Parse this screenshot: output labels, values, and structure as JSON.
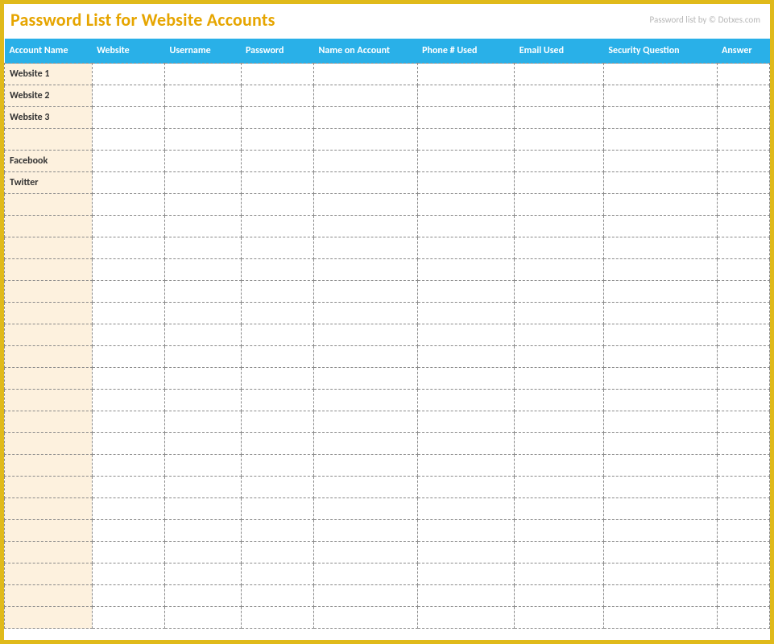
{
  "header": {
    "title": "Password List for Website Accounts",
    "credit": "Password list by © Dotxes.com"
  },
  "columns": {
    "account_name": "Account Name",
    "website": "Website",
    "username": "Username",
    "password": "Password",
    "name_on_account": "Name on Account",
    "phone_used": "Phone # Used",
    "email_used": "Email Used",
    "security_question": "Security Question",
    "answer": "Answer"
  },
  "rows": [
    {
      "account_name": "Website 1",
      "website": "",
      "username": "",
      "password": "",
      "name_on_account": "",
      "phone_used": "",
      "email_used": "",
      "security_question": "",
      "answer": ""
    },
    {
      "account_name": "Website 2",
      "website": "",
      "username": "",
      "password": "",
      "name_on_account": "",
      "phone_used": "",
      "email_used": "",
      "security_question": "",
      "answer": ""
    },
    {
      "account_name": "Website 3",
      "website": "",
      "username": "",
      "password": "",
      "name_on_account": "",
      "phone_used": "",
      "email_used": "",
      "security_question": "",
      "answer": ""
    },
    {
      "account_name": "",
      "website": "",
      "username": "",
      "password": "",
      "name_on_account": "",
      "phone_used": "",
      "email_used": "",
      "security_question": "",
      "answer": ""
    },
    {
      "account_name": "Facebook",
      "website": "",
      "username": "",
      "password": "",
      "name_on_account": "",
      "phone_used": "",
      "email_used": "",
      "security_question": "",
      "answer": ""
    },
    {
      "account_name": "Twitter",
      "website": "",
      "username": "",
      "password": "",
      "name_on_account": "",
      "phone_used": "",
      "email_used": "",
      "security_question": "",
      "answer": ""
    },
    {
      "account_name": "",
      "website": "",
      "username": "",
      "password": "",
      "name_on_account": "",
      "phone_used": "",
      "email_used": "",
      "security_question": "",
      "answer": ""
    },
    {
      "account_name": "",
      "website": "",
      "username": "",
      "password": "",
      "name_on_account": "",
      "phone_used": "",
      "email_used": "",
      "security_question": "",
      "answer": ""
    },
    {
      "account_name": "",
      "website": "",
      "username": "",
      "password": "",
      "name_on_account": "",
      "phone_used": "",
      "email_used": "",
      "security_question": "",
      "answer": ""
    },
    {
      "account_name": "",
      "website": "",
      "username": "",
      "password": "",
      "name_on_account": "",
      "phone_used": "",
      "email_used": "",
      "security_question": "",
      "answer": ""
    },
    {
      "account_name": "",
      "website": "",
      "username": "",
      "password": "",
      "name_on_account": "",
      "phone_used": "",
      "email_used": "",
      "security_question": "",
      "answer": ""
    },
    {
      "account_name": "",
      "website": "",
      "username": "",
      "password": "",
      "name_on_account": "",
      "phone_used": "",
      "email_used": "",
      "security_question": "",
      "answer": ""
    },
    {
      "account_name": "",
      "website": "",
      "username": "",
      "password": "",
      "name_on_account": "",
      "phone_used": "",
      "email_used": "",
      "security_question": "",
      "answer": ""
    },
    {
      "account_name": "",
      "website": "",
      "username": "",
      "password": "",
      "name_on_account": "",
      "phone_used": "",
      "email_used": "",
      "security_question": "",
      "answer": ""
    },
    {
      "account_name": "",
      "website": "",
      "username": "",
      "password": "",
      "name_on_account": "",
      "phone_used": "",
      "email_used": "",
      "security_question": "",
      "answer": ""
    },
    {
      "account_name": "",
      "website": "",
      "username": "",
      "password": "",
      "name_on_account": "",
      "phone_used": "",
      "email_used": "",
      "security_question": "",
      "answer": ""
    },
    {
      "account_name": "",
      "website": "",
      "username": "",
      "password": "",
      "name_on_account": "",
      "phone_used": "",
      "email_used": "",
      "security_question": "",
      "answer": ""
    },
    {
      "account_name": "",
      "website": "",
      "username": "",
      "password": "",
      "name_on_account": "",
      "phone_used": "",
      "email_used": "",
      "security_question": "",
      "answer": ""
    },
    {
      "account_name": "",
      "website": "",
      "username": "",
      "password": "",
      "name_on_account": "",
      "phone_used": "",
      "email_used": "",
      "security_question": "",
      "answer": ""
    },
    {
      "account_name": "",
      "website": "",
      "username": "",
      "password": "",
      "name_on_account": "",
      "phone_used": "",
      "email_used": "",
      "security_question": "",
      "answer": ""
    },
    {
      "account_name": "",
      "website": "",
      "username": "",
      "password": "",
      "name_on_account": "",
      "phone_used": "",
      "email_used": "",
      "security_question": "",
      "answer": ""
    },
    {
      "account_name": "",
      "website": "",
      "username": "",
      "password": "",
      "name_on_account": "",
      "phone_used": "",
      "email_used": "",
      "security_question": "",
      "answer": ""
    },
    {
      "account_name": "",
      "website": "",
      "username": "",
      "password": "",
      "name_on_account": "",
      "phone_used": "",
      "email_used": "",
      "security_question": "",
      "answer": ""
    },
    {
      "account_name": "",
      "website": "",
      "username": "",
      "password": "",
      "name_on_account": "",
      "phone_used": "",
      "email_used": "",
      "security_question": "",
      "answer": ""
    },
    {
      "account_name": "",
      "website": "",
      "username": "",
      "password": "",
      "name_on_account": "",
      "phone_used": "",
      "email_used": "",
      "security_question": "",
      "answer": ""
    },
    {
      "account_name": "",
      "website": "",
      "username": "",
      "password": "",
      "name_on_account": "",
      "phone_used": "",
      "email_used": "",
      "security_question": "",
      "answer": ""
    }
  ]
}
